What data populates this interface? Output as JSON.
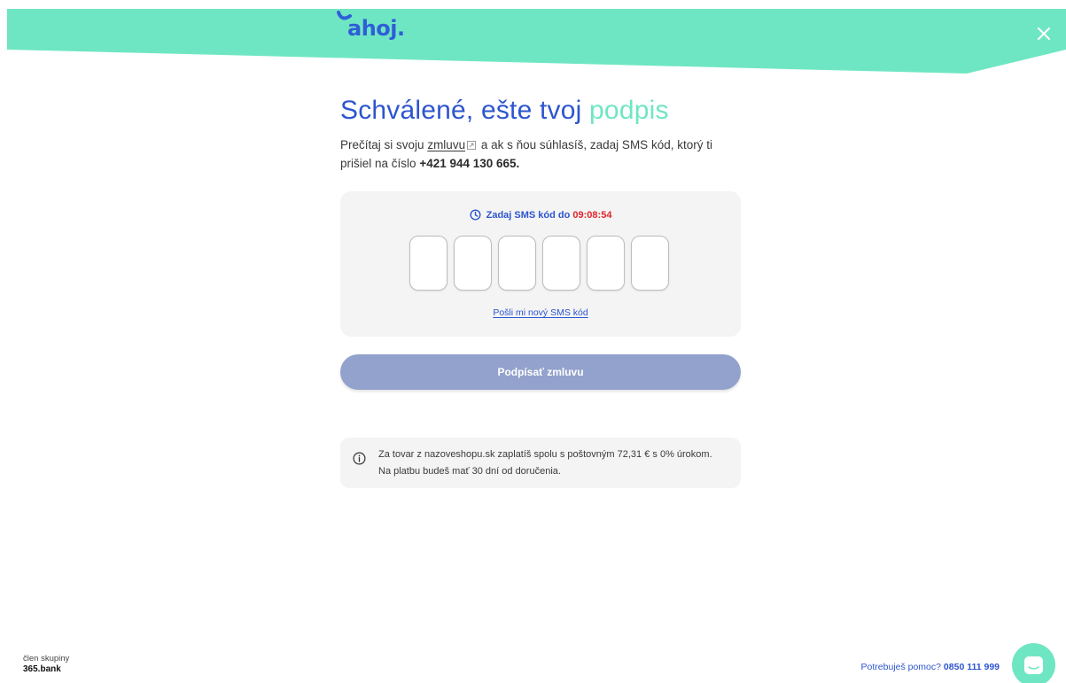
{
  "header": {
    "logo_text": "ahoj.",
    "brand_color": "#6fe6c3",
    "accent_color": "#2d55cf",
    "close_icon": "close-icon"
  },
  "main": {
    "title_main": "Schválené, ešte tvoj",
    "title_accent": "podpis",
    "lead_before": "Prečítaj si svoju",
    "lead_link": "zmluvu",
    "lead_after": "a ak s ňou súhlasíš, zadaj SMS kód, ktorý ti prišiel na číslo",
    "phone": "+421 944 130 665."
  },
  "sms": {
    "timer_label": "Zadaj SMS kód do",
    "countdown": "09:08:54",
    "code_values": [
      "",
      "",
      "",
      "",
      "",
      ""
    ],
    "resend_label": "Pošli mi nový SMS kód"
  },
  "actions": {
    "sign_label": "Podpísať zmluvu"
  },
  "info": {
    "text": "Za tovar z nazoveshopu.sk zaplatíš spolu s poštovným 72,31 € s 0% úrokom. Na platbu budeš mať 30 dní od doručenia."
  },
  "footer": {
    "group_label": "člen skupiny",
    "group_bank": "365.bank",
    "help_label": "Potrebuješ pomoc?",
    "help_phone": "0850 111 999"
  }
}
